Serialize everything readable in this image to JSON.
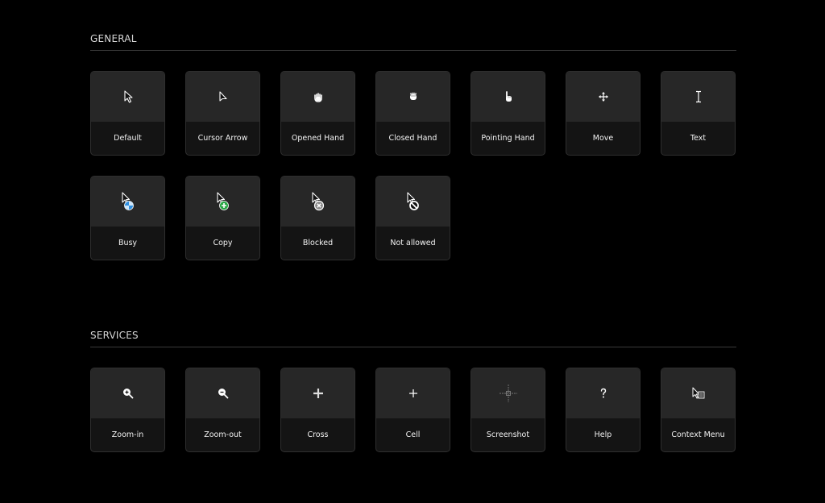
{
  "sections": {
    "general": {
      "title": "GENERAL",
      "items": [
        {
          "label": "Default",
          "icon": "default-arrow-icon"
        },
        {
          "label": "Cursor Arrow",
          "icon": "cursor-arrow-icon"
        },
        {
          "label": "Opened Hand",
          "icon": "opened-hand-icon"
        },
        {
          "label": "Closed Hand",
          "icon": "closed-hand-icon"
        },
        {
          "label": "Pointing Hand",
          "icon": "pointing-hand-icon"
        },
        {
          "label": "Move",
          "icon": "move-icon"
        },
        {
          "label": "Text",
          "icon": "text-ibeam-icon"
        },
        {
          "label": "Busy",
          "icon": "busy-icon"
        },
        {
          "label": "Copy",
          "icon": "copy-icon"
        },
        {
          "label": "Blocked",
          "icon": "blocked-icon"
        },
        {
          "label": "Not allowed",
          "icon": "not-allowed-icon"
        }
      ]
    },
    "services": {
      "title": "SERVICES",
      "items": [
        {
          "label": "Zoom-in",
          "icon": "zoom-in-icon"
        },
        {
          "label": "Zoom-out",
          "icon": "zoom-out-icon"
        },
        {
          "label": "Cross",
          "icon": "cross-icon"
        },
        {
          "label": "Cell",
          "icon": "cell-icon"
        },
        {
          "label": "Screenshot",
          "icon": "screenshot-icon"
        },
        {
          "label": "Help",
          "icon": "help-icon"
        },
        {
          "label": "Context Menu",
          "icon": "context-menu-icon"
        }
      ]
    }
  },
  "colors": {
    "background": "#000000",
    "card_top": "#272727",
    "card_bottom": "#141414",
    "busy_blue": "#2f8fe0",
    "copy_green": "#28a745",
    "blocked_gray": "#8a8a8a"
  }
}
